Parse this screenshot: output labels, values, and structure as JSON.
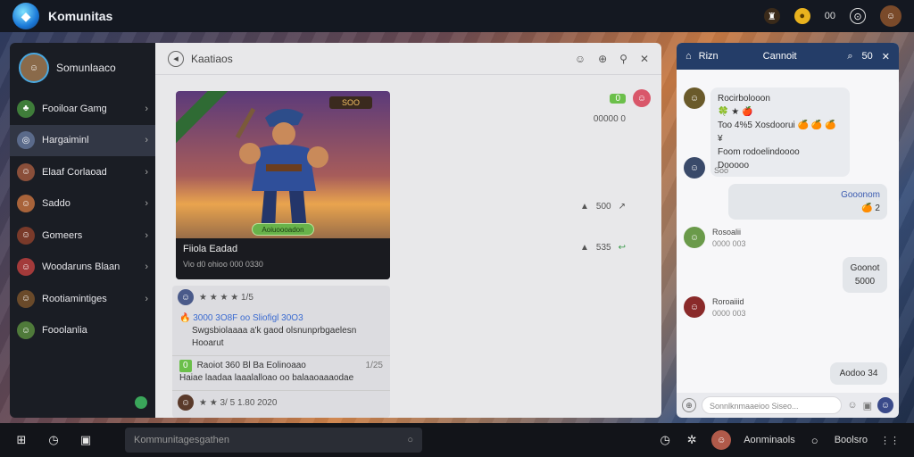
{
  "app": {
    "title": "Komunitas"
  },
  "topbar": {
    "status_text": "00"
  },
  "sidebar": {
    "profile_name": "Somunlaaco",
    "items": [
      {
        "label": "Fooiloar Gamg",
        "avatar_color": "#3f7d3a"
      },
      {
        "label": "Hargaiminl",
        "avatar_color": "#5a6a8a"
      },
      {
        "label": "Elaaf Corlaoad",
        "avatar_color": "#8a4f3a"
      },
      {
        "label": "Saddo",
        "avatar_color": "#a8633a"
      },
      {
        "label": "Gomeers",
        "avatar_color": "#7a3a2a"
      },
      {
        "label": "Woodaruns Blaan",
        "avatar_color": "#a33a3a"
      },
      {
        "label": "Rootiamintiges",
        "avatar_color": "#6a4a2a"
      },
      {
        "label": "Fooolanlia",
        "avatar_color": "#4f7a3a"
      }
    ]
  },
  "post": {
    "header_title": "Kaatiaos",
    "card_badge": "SOO",
    "card_pill": "Aoiuoooadon",
    "card_title": "Fiiola Eadad",
    "card_subtitle": "Vio d0 ohioo 000 0330",
    "right_tag": "0",
    "right_count": "00000 0",
    "stat1": "500",
    "stat2": "535",
    "comments": [
      {
        "rating": "★ ★ ★ ★ 1/5"
      },
      {
        "head": "3000 3O8F oo Sliofigl 30O3",
        "body": "Swgsbiolaaaa a'k gaod olsnunprbgaelesn Hooarut"
      },
      {
        "tag": "0",
        "head": "Raoiot 360 Bl Ba Eolinoaao",
        "count": "1/25",
        "body": "Haiae laadaa laaalalloao oo balaaoaaaodae"
      },
      {
        "rating": "★ ★ 3/ 5 1.80 2020"
      }
    ]
  },
  "chat": {
    "header_left": "Rizn",
    "header_title": "Cannoit",
    "header_count": "50",
    "messages": [
      {
        "name": "Rocirbolooon",
        "line1": "🍀 ★ 🍎",
        "line2": "Too 4%5 Xosdoorui 🍊 🍊 🍊 ¥",
        "line3": "Foom rodoelindoooo",
        "line4": "Dooooo"
      },
      {
        "sub": "Soo"
      },
      {
        "text": "Gooonom",
        "emoji": "🍊 2"
      },
      {
        "name": "Rosoalii",
        "sub": "0000 003"
      },
      {
        "text": "Goonot",
        "sub": "5000"
      },
      {
        "name": "Roroaiiid",
        "sub": "0000 003"
      },
      {
        "text": "Aodoo 34"
      }
    ],
    "input_placeholder": "Sonnlknmaaeioo Siseo..."
  },
  "bottombar": {
    "search_placeholder": "Kommunitagesgathen",
    "user_name": "Aonminaols",
    "status_label": "Boolsro"
  }
}
